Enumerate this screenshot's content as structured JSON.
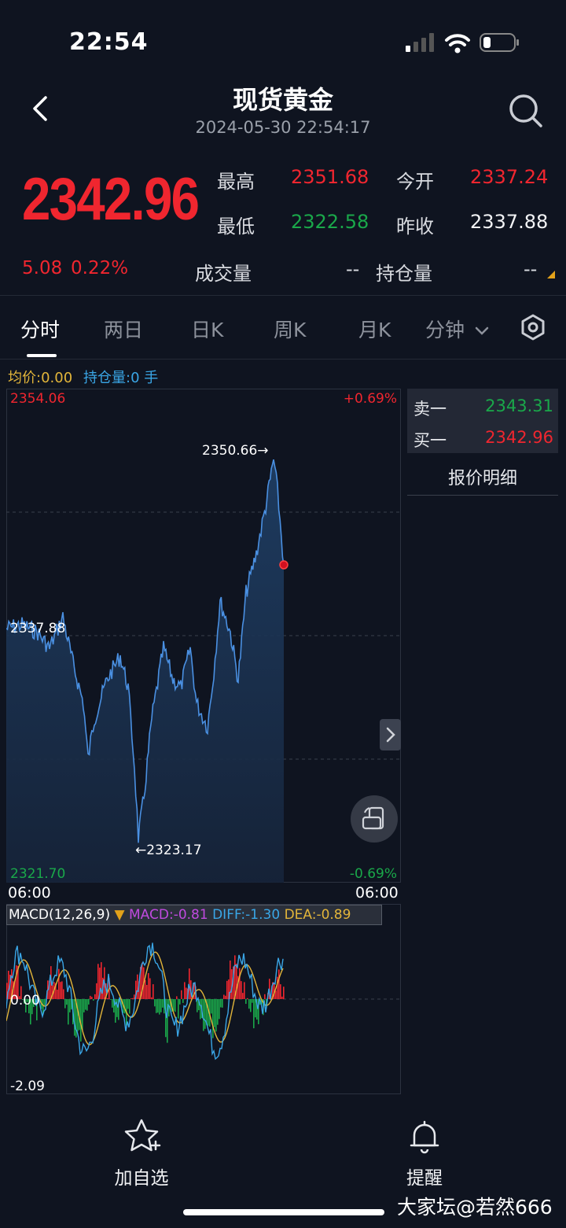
{
  "status_bar": {
    "time": "22:54"
  },
  "header": {
    "title": "现货黄金",
    "datetime": "2024-05-30 22:54:17"
  },
  "quote": {
    "price": "2342.96",
    "change": "5.08",
    "change_pct": "0.22%",
    "high_label": "最高",
    "high": "2351.68",
    "open_label": "今开",
    "open": "2337.24",
    "low_label": "最低",
    "low": "2322.58",
    "prev_close_label": "昨收",
    "prev_close": "2337.88",
    "volume_label": "成交量",
    "volume": "--",
    "open_interest_label": "持仓量",
    "open_interest": "--"
  },
  "tabs": [
    "分时",
    "两日",
    "日K",
    "周K",
    "月K",
    "分钟"
  ],
  "info_line": {
    "avg": "均价:0.00",
    "position": "持仓量:0 手"
  },
  "chart": {
    "y_max_label": "2354.06",
    "y_min_label": "2321.70",
    "pct_max_label": "+0.69%",
    "pct_min_label": "-0.69%",
    "prev_close_label": "2337.88",
    "high_annotation": "2350.66→",
    "low_annotation": "←2323.17",
    "time_start": "06:00",
    "time_end": "06:00"
  },
  "macd": {
    "title": "MACD(12,26,9)",
    "macd": "MACD:-0.81",
    "diff": "DIFF:-1.30",
    "dea": "DEA:-0.89",
    "zero_label": "0.00",
    "min_label": "-2.09"
  },
  "orderbook": {
    "ask_label": "卖一",
    "ask": "2343.31",
    "bid_label": "买一",
    "bid": "2342.96",
    "detail_link": "报价明细"
  },
  "bottom_bar": {
    "favorite": "加自选",
    "alert": "提醒"
  },
  "watermark": "大家坛@若然666",
  "colors": {
    "up": "#f0262f",
    "down": "#1aa84a",
    "line": "#4a90e2",
    "accent": "#e2b53a"
  }
}
